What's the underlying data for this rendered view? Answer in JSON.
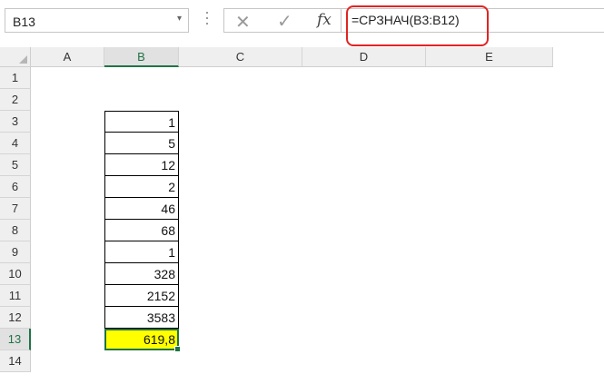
{
  "formula_bar": {
    "name_box": "B13",
    "name_box_dropdown": "▾",
    "cancel_icon_glyph": "✕",
    "enter_icon_glyph": "✓",
    "fx_label": "fx",
    "formula": "=СРЗНАЧ(B3:B12)",
    "highlight_color": "#e02424"
  },
  "grid": {
    "columns": [
      "A",
      "B",
      "C",
      "D",
      "E"
    ],
    "rows": [
      "1",
      "2",
      "3",
      "4",
      "5",
      "6",
      "7",
      "8",
      "9",
      "10",
      "11",
      "12",
      "13",
      "14"
    ],
    "active_cell": "B13",
    "cells_b": [
      "1",
      "5",
      "12",
      "2",
      "46",
      "68",
      "1",
      "328",
      "2152",
      "3583",
      "619,8"
    ],
    "selected_fill": "#ffff00",
    "selection_color": "#217346"
  }
}
